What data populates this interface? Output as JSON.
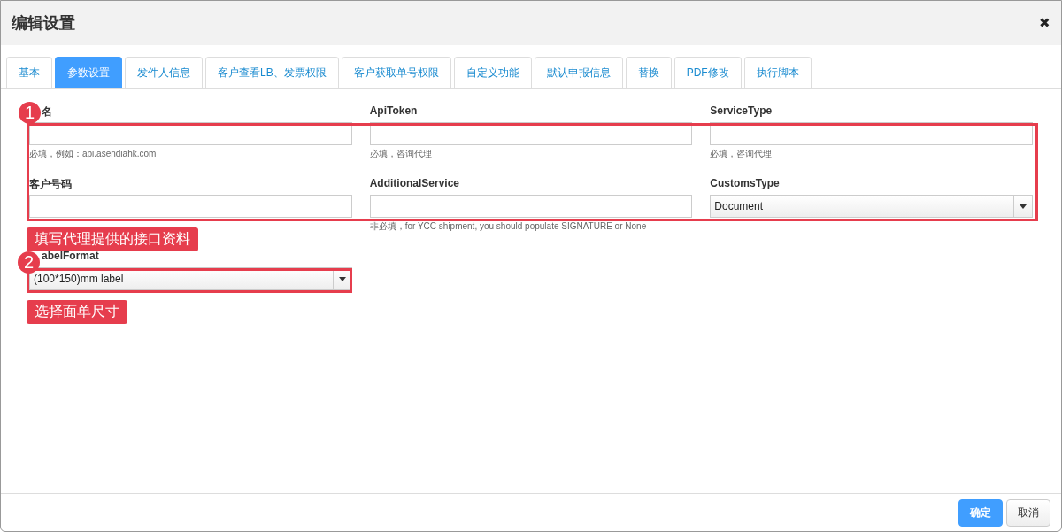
{
  "dialog": {
    "title": "编辑设置",
    "close": "✖"
  },
  "tabs": [
    {
      "label": "基本",
      "selected": false
    },
    {
      "label": "参数设置",
      "selected": true
    },
    {
      "label": "发件人信息",
      "selected": false
    },
    {
      "label": "客户查看LB、发票权限",
      "selected": false
    },
    {
      "label": "客户获取单号权限",
      "selected": false
    },
    {
      "label": "自定义功能",
      "selected": false
    },
    {
      "label": "默认申报信息",
      "selected": false
    },
    {
      "label": "替换",
      "selected": false
    },
    {
      "label": "PDF修改",
      "selected": false
    },
    {
      "label": "执行脚本",
      "selected": false
    }
  ],
  "fields": [
    {
      "kind": "input",
      "label": "名",
      "hint": "必填，例如：api.asendiahk.com"
    },
    {
      "kind": "input",
      "label": "ApiToken",
      "hint": "必填，咨询代理"
    },
    {
      "kind": "input",
      "label": "ServiceType",
      "hint": "必填，咨询代理"
    },
    {
      "kind": "input",
      "label": "客户号码"
    },
    {
      "kind": "input",
      "label": "AdditionalService",
      "hint": "非必填，for YCC shipment, you should populate SIGNATURE or None"
    },
    {
      "kind": "select",
      "label": "CustomsType",
      "value": "Document"
    },
    {
      "kind": "select",
      "label": "abelFormat",
      "value": "(100*150)mm label"
    }
  ],
  "annotations": [
    {
      "number": "1",
      "label": "填写代理提供的接口资料"
    },
    {
      "number": "2",
      "label": "选择面单尺寸"
    }
  ],
  "buttons": [
    {
      "label": "确定",
      "primary": true
    },
    {
      "label": "取消",
      "primary": false
    }
  ]
}
